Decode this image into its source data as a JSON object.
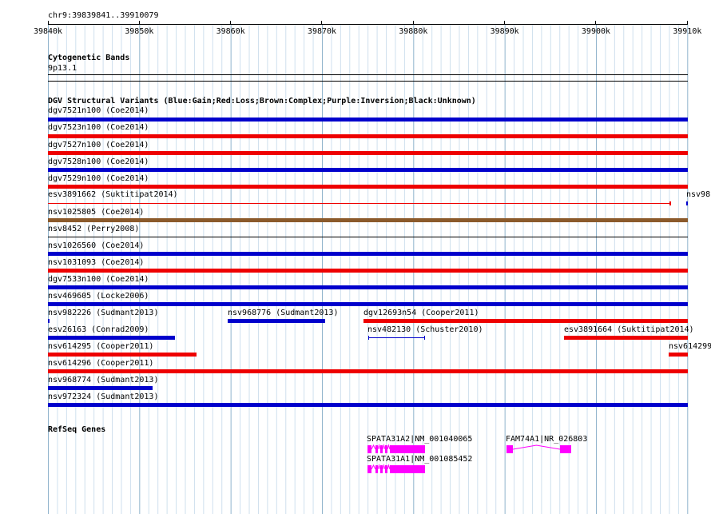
{
  "ruler": {
    "range_label": "chr9:39839841..39910079",
    "ticks": [
      "39840k",
      "39850k",
      "39860k",
      "39870k",
      "39880k",
      "39890k",
      "39900k",
      "39910k"
    ]
  },
  "tracks": {
    "cyto": {
      "title": "Cytogenetic Bands",
      "band": "9p13.1"
    },
    "dgv": {
      "title": "DGV Structural Variants (Blue:Gain;Red:Loss;Brown:Complex;Purple:Inversion;Black:Unknown)",
      "colors": {
        "gain": "#0000cc",
        "loss": "#ee0000",
        "complex": "#8b5a2b",
        "unknown": "#000000"
      },
      "features": [
        {
          "label": "dgv7521n100 (Coe2014)",
          "type": "gain"
        },
        {
          "label": "dgv7523n100 (Coe2014)",
          "type": "loss"
        },
        {
          "label": "dgv7527n100 (Coe2014)",
          "type": "loss"
        },
        {
          "label": "dgv7528n100 (Coe2014)",
          "type": "gain"
        },
        {
          "label": "dgv7529n100 (Coe2014)",
          "type": "loss"
        },
        {
          "label": "esv3891662 (Suktitipat2014)",
          "type": "loss"
        },
        {
          "label": "nsv98",
          "type": "gain"
        },
        {
          "label": "nsv1025805 (Coe2014)",
          "type": "complex"
        },
        {
          "label": "nsv8452 (Perry2008)",
          "type": "unknown"
        },
        {
          "label": "nsv1026560 (Coe2014)",
          "type": "gain"
        },
        {
          "label": "nsv1031093 (Coe2014)",
          "type": "loss"
        },
        {
          "label": "dgv7533n100 (Coe2014)",
          "type": "gain"
        },
        {
          "label": "nsv469605 (Locke2006)",
          "type": "gain"
        },
        {
          "label": "nsv982226 (Sudmant2013)",
          "type": "gain"
        },
        {
          "label": "nsv968776 (Sudmant2013)",
          "type": "gain"
        },
        {
          "label": "dgv12693n54 (Cooper2011)",
          "type": "loss"
        },
        {
          "label": "esv26163 (Conrad2009)",
          "type": "gain"
        },
        {
          "label": "nsv482130 (Schuster2010)",
          "type": "gain"
        },
        {
          "label": "esv3891664 (Suktitipat2014)",
          "type": "loss"
        },
        {
          "label": "nsv614295 (Cooper2011)",
          "type": "loss"
        },
        {
          "label": "nsv614299",
          "type": "loss"
        },
        {
          "label": "nsv614296 (Cooper2011)",
          "type": "loss"
        },
        {
          "label": "nsv968774 (Sudmant2013)",
          "type": "gain"
        },
        {
          "label": "nsv972324 (Sudmant2013)",
          "type": "gain"
        }
      ]
    },
    "refseq": {
      "title": "RefSeq Genes",
      "color": "#ff00ff",
      "genes": [
        {
          "label": "SPATA31A2|NM_001040065"
        },
        {
          "label": "SPATA31A1|NM_001085452"
        },
        {
          "label": "FAM74A1|NR_026803"
        }
      ]
    }
  }
}
